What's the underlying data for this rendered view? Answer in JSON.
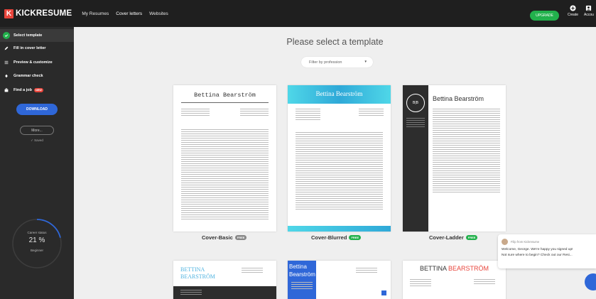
{
  "brand": {
    "name": "KICKRESUME",
    "logo_letter": "K"
  },
  "nav": {
    "items": [
      "My Resumes",
      "Cover letters",
      "Websites"
    ]
  },
  "top_actions": {
    "upgrade_label": "UPGRADE",
    "create_label": "Create",
    "account_label": "Accou"
  },
  "sidebar": {
    "items": [
      {
        "label": "Select template",
        "icon": "check-icon"
      },
      {
        "label": "Fill in cover letter",
        "icon": "pencil-icon"
      },
      {
        "label": "Preview & customize",
        "icon": "sliders-icon"
      },
      {
        "label": "Grammar check",
        "icon": "spellcheck-icon"
      },
      {
        "label": "Find a job",
        "icon": "briefcase-icon",
        "badge": "NEW"
      }
    ],
    "download_label": "DOWNLOAD",
    "more_label": "More...",
    "saved_label": "✓ Saved",
    "status": {
      "title": "Career status",
      "percent": "21 %",
      "level": "Beginner",
      "progress": 0.21
    }
  },
  "main": {
    "title": "Please select a template",
    "filter_placeholder": "Filter by profession",
    "templates": [
      {
        "name": "Cover-Basic",
        "badge": "FREE",
        "heading": "Bettina Bearström",
        "accent": "#888888"
      },
      {
        "name": "Cover-Blurred",
        "badge": "FREE",
        "heading": "Bettina Bearström",
        "accent": "#22b14c"
      },
      {
        "name": "Cover-Ladder",
        "badge": "FREE",
        "heading": "Bettina Bearström",
        "monogram": "B|B",
        "accent": "#22b14c"
      },
      {
        "heading": "BETTINA BEARSTRÖM"
      },
      {
        "heading": "Bettina Bearström"
      },
      {
        "heading_first": "BETTINA ",
        "heading_last": "BEARSTRÖM"
      }
    ]
  },
  "chat": {
    "from": "Filip from Kickresume",
    "line1": "Welcome, George. We're happy you signed up!",
    "line2": "Not sure where to begin? Check out our Resi..."
  },
  "colors": {
    "accent_green": "#22b14c",
    "accent_blue": "#2f67d8",
    "brand_red": "#e8453c",
    "dark_bg": "#1f1f1f"
  }
}
